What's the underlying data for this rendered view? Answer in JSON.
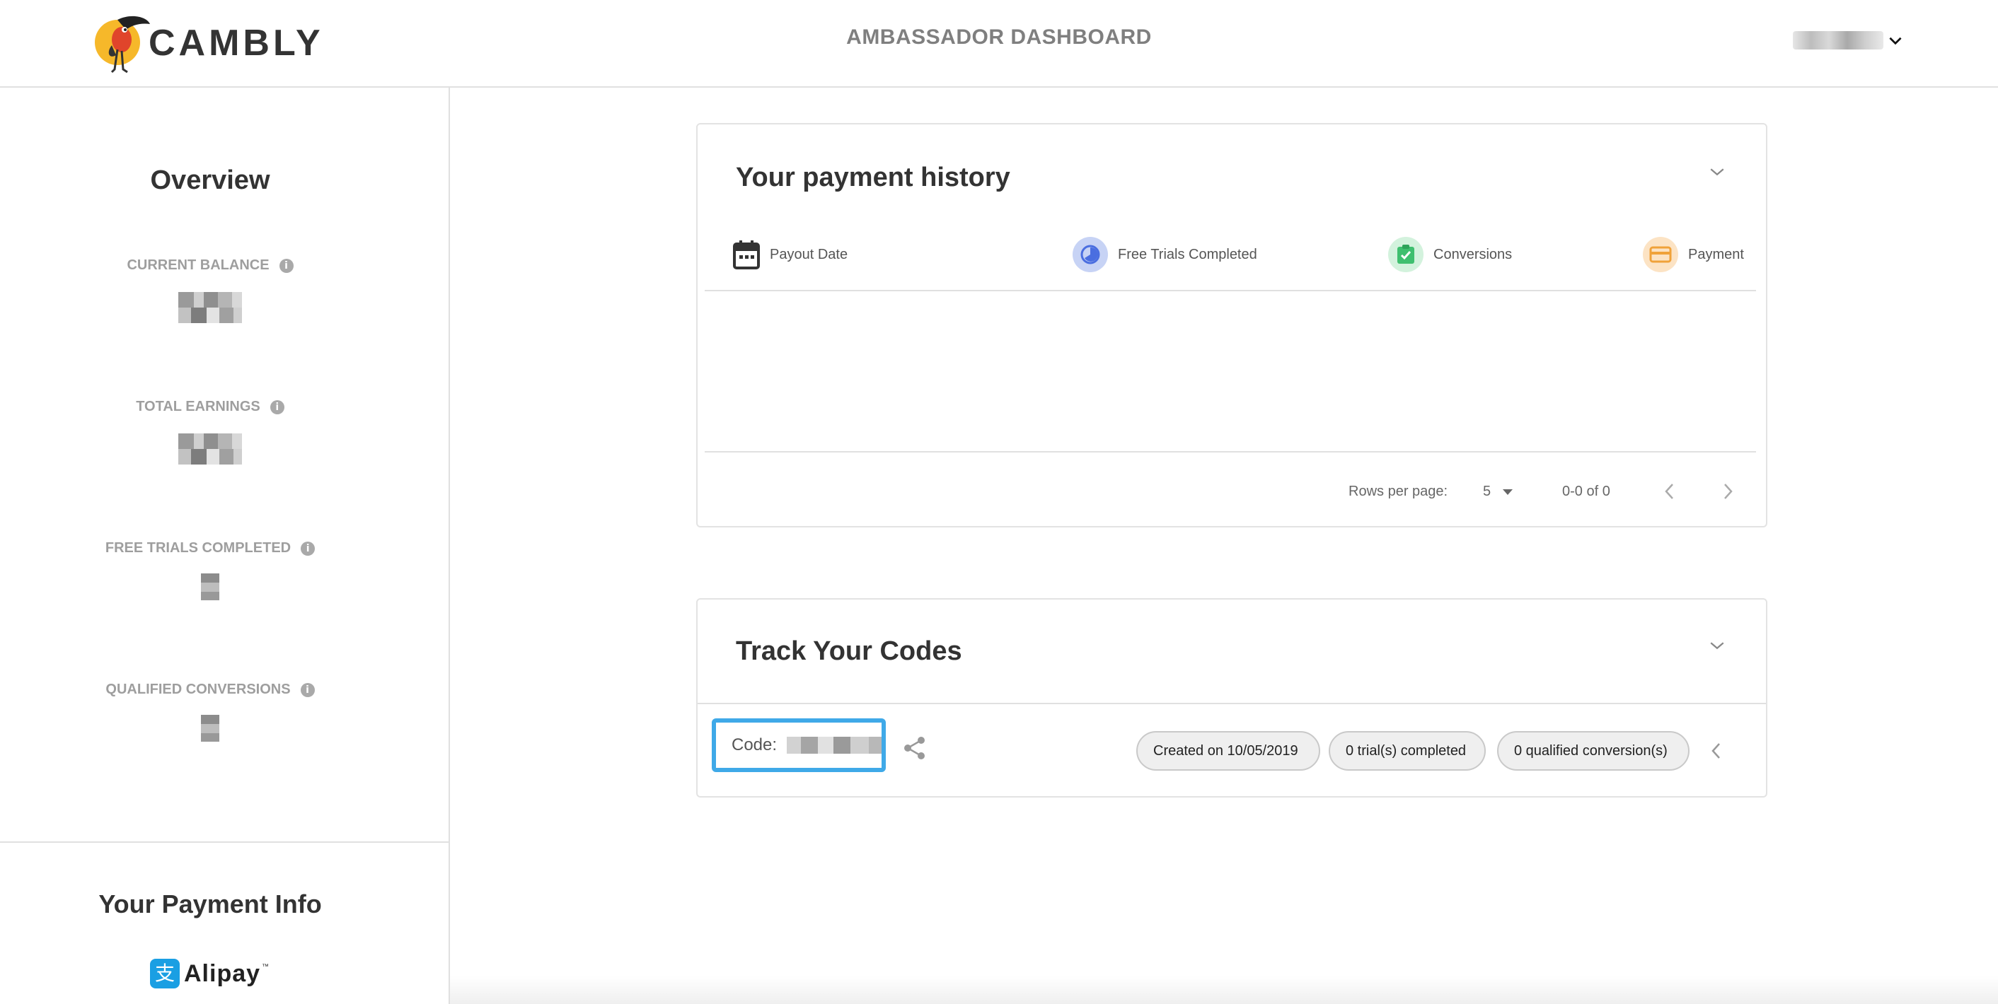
{
  "header": {
    "brand": "CAMBLY",
    "title": "AMBASSADOR DASHBOARD"
  },
  "sidebar": {
    "overview_title": "Overview",
    "stats": [
      {
        "label": "CURRENT BALANCE"
      },
      {
        "label": "TOTAL EARNINGS"
      },
      {
        "label": "FREE TRIALS COMPLETED"
      },
      {
        "label": "QUALIFIED CONVERSIONS"
      }
    ],
    "info_glyph": "i",
    "payment_info_title": "Your Payment Info",
    "payment_method": "Alipay",
    "payment_method_tm": "™",
    "alipay_glyph": "支"
  },
  "payment_history": {
    "title": "Your payment history",
    "columns": [
      {
        "label": "Payout Date",
        "icon": "calendar-icon"
      },
      {
        "label": "Free Trials Completed",
        "icon": "clock-icon",
        "color": "#c7d3f5"
      },
      {
        "label": "Conversions",
        "icon": "check-icon",
        "color": "#d3f2dd"
      },
      {
        "label": "Payment",
        "icon": "card-icon",
        "color": "#fce3c4"
      }
    ],
    "pager": {
      "rows_label": "Rows per page:",
      "rows_value": "5",
      "range": "0-0 of 0"
    }
  },
  "codes": {
    "title": "Track Your Codes",
    "code_label": "Code:",
    "created": "Created on 10/05/2019",
    "trials": "0 trial(s) completed",
    "conversions": "0 qualified conversion(s)"
  },
  "colors": {
    "accent_blue": "#3fa9e8",
    "brand_yellow": "#f6b82a",
    "brand_red": "#e0452b"
  }
}
